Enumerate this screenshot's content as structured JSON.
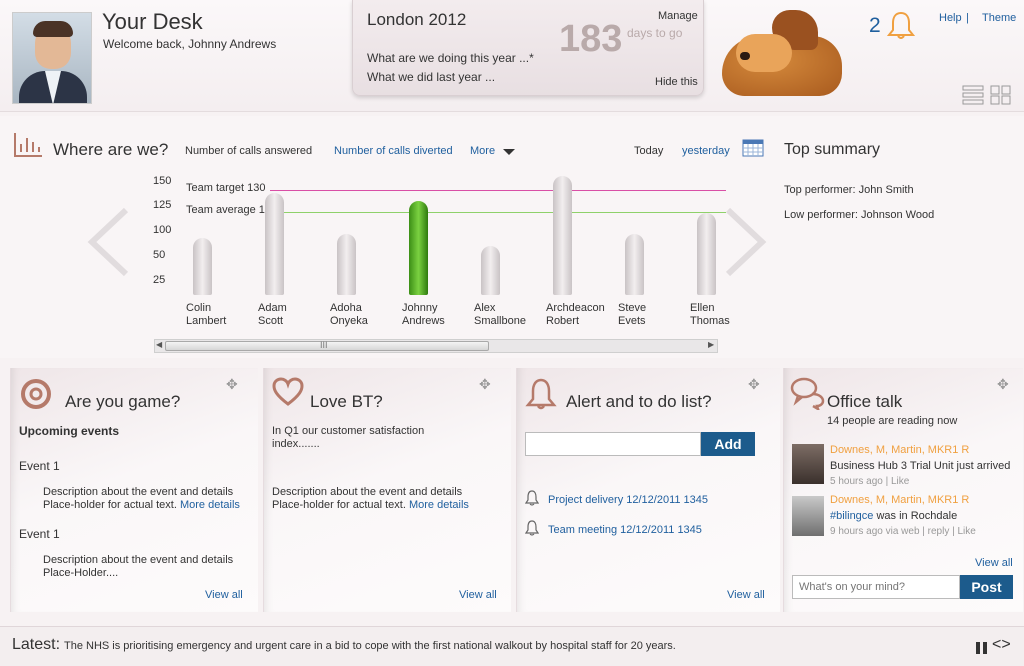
{
  "header": {
    "title": "Your Desk",
    "welcome": "Welcome back, Johnny Andrews",
    "notification_count": "2",
    "help": "Help",
    "separator": "|",
    "theme": "Theme"
  },
  "countdown": {
    "title": "London 2012",
    "question1": "What are we doing this year ...*",
    "question2": "What we did last year ...",
    "days": "183",
    "days_label": "days to go",
    "manage": "Manage",
    "hide": "Hide this"
  },
  "performance": {
    "title": "Where are we?",
    "tabs": [
      "Number of calls answered",
      "Number of calls diverted",
      "More"
    ],
    "periods": [
      "Today",
      "yesterday"
    ],
    "summary_title": "Top summary",
    "top_performer": "Top performer: John Smith",
    "low_performer": "Low performer: Johnson Wood",
    "scroll_grip": "III"
  },
  "chart_data": {
    "type": "bar",
    "categories": [
      "Colin Lambert",
      "Adam Scott",
      "Adoha Onyeka",
      "Johnny Andrews",
      "Alex Smallbone",
      "Archdeacon Robert",
      "Steve Evets",
      "Ellen Thomas"
    ],
    "category_lines": [
      [
        "Colin",
        "Lambert"
      ],
      [
        "Adam",
        "Scott"
      ],
      [
        "Adoha",
        "Onyeka"
      ],
      [
        "Johnny",
        "Andrews"
      ],
      [
        "Alex",
        "Smallbone"
      ],
      [
        "Archdeacon",
        "Robert"
      ],
      [
        "Steve",
        "Evets"
      ],
      [
        "Ellen",
        "Thomas"
      ]
    ],
    "values": [
      70,
      125,
      75,
      115,
      60,
      145,
      75,
      100
    ],
    "highlight_index": 3,
    "yticks": [
      150,
      125,
      100,
      50,
      25
    ],
    "reference_lines": [
      {
        "label": "Team target 130",
        "value": 130,
        "color": "#d94fa6"
      },
      {
        "label": "Team average 122",
        "value": 122,
        "color": "#8fd16a"
      }
    ]
  },
  "cards": {
    "game": {
      "title": "Are you game?",
      "subtitle": "Upcoming events",
      "event1_title": "Event 1",
      "event1_desc_1": "Description about the event and details",
      "event1_desc_2": "Place-holder for actual text.",
      "event1_more": "More details",
      "event2_title": "Event 1",
      "event2_desc_1": "Description about the event and details",
      "event2_desc_2": "Place-Holder....",
      "view_all": "View all"
    },
    "bt": {
      "title": "Love BT?",
      "intro_1": "In Q1 our customer satisfaction",
      "intro_2": "index.......",
      "desc_1": "Description about the event and details",
      "desc_2": "Place-holder for actual text.",
      "more": "More details",
      "view_all": "View all"
    },
    "alert": {
      "title": "Alert and to do list?",
      "add_label": "Add",
      "items": [
        "Project delivery 12/12/2011 1345",
        "Team meeting 12/12/2011 1345"
      ],
      "view_all": "View all"
    },
    "talk": {
      "title": "Office talk",
      "reading": "14 people are reading now",
      "posts": [
        {
          "name": "Downes, M, Martin, MKR1 R",
          "text_prefix": "",
          "tag": "",
          "text": "Business Hub 3 Trial Unit just arrived",
          "meta": "5 hours ago | Like"
        },
        {
          "name": "Downes, M, Martin, MKR1 R",
          "text_prefix": "",
          "tag": "#bilingce",
          "text": " was in Rochdale",
          "meta": "9 hours ago via web | reply | Like"
        }
      ],
      "view_all": "View all",
      "placeholder": "What's on your mind?",
      "post_label": "Post"
    }
  },
  "footer": {
    "label": "Latest:",
    "text": "The NHS is  prioritising emergency and urgent care in a bid to cope with the first national walkout  by hospital staff for 20 years.",
    "nav": "<>"
  },
  "colors": {
    "accent": "#1c5b8c",
    "link": "#1f5f9e",
    "highlight_bar": "#4caf2a",
    "notify": "#f0a040"
  }
}
